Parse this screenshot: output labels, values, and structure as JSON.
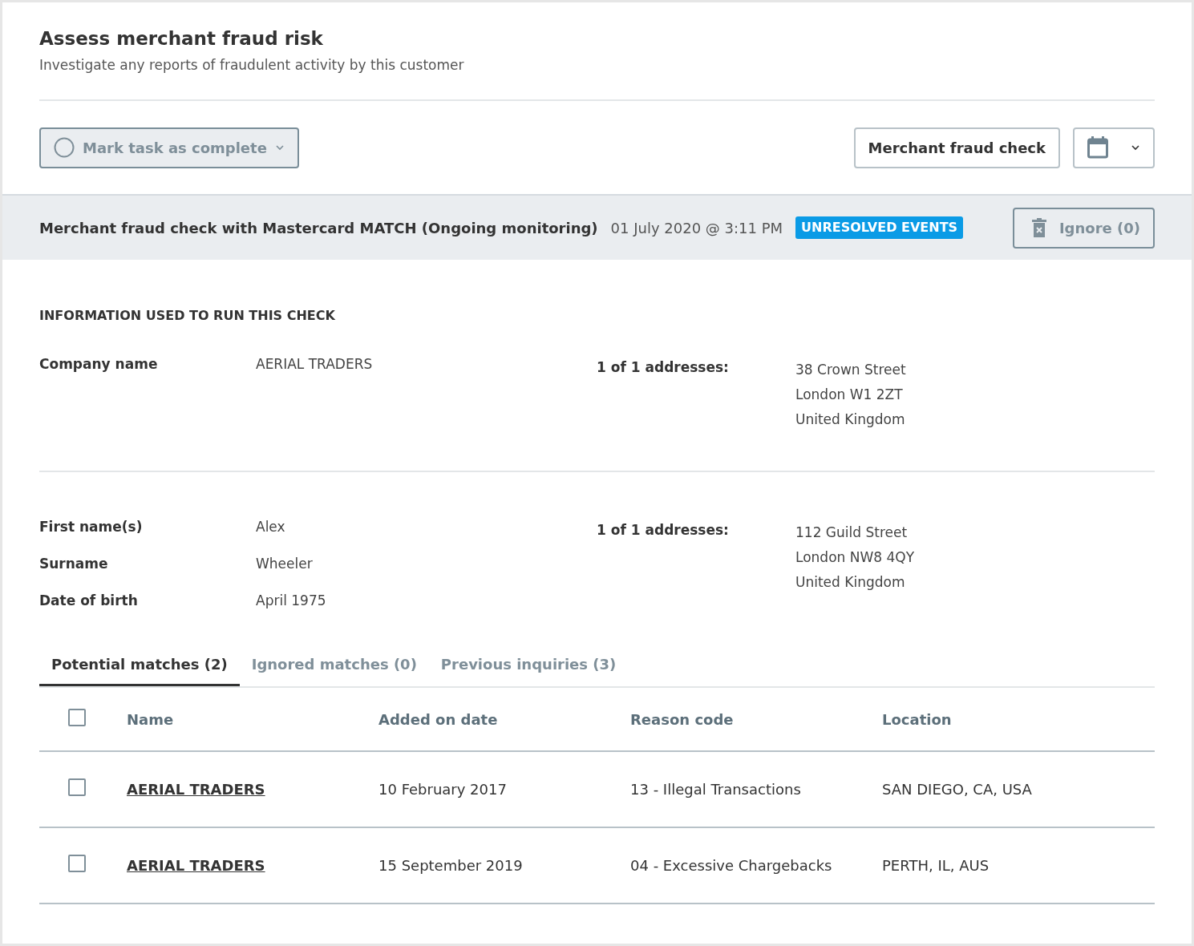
{
  "header": {
    "title": "Assess merchant fraud risk",
    "subtitle": "Investigate any reports of fraudulent activity by this customer"
  },
  "toolbar": {
    "complete_button": {
      "label": "Mark task as complete",
      "disabled": true
    },
    "check_button": {
      "label": "Merchant fraud check"
    }
  },
  "check": {
    "title": "Merchant fraud check with Mastercard MATCH (Ongoing monitoring)",
    "date": "01 July 2020 @ 3:11 PM",
    "status": "UNRESOLVED EVENTS",
    "ignore_button": {
      "label": "Ignore (0)",
      "disabled": true
    }
  },
  "info": {
    "heading": "INFORMATION USED TO RUN THIS CHECK",
    "sections": [
      {
        "fields": [
          {
            "label": "Company name",
            "value": "AERIAL TRADERS"
          }
        ],
        "address_label": "1 of 1 addresses:",
        "address_lines": [
          "38 Crown Street",
          "London W1 2ZT",
          "United Kingdom"
        ]
      },
      {
        "fields": [
          {
            "label": "First name(s)",
            "value": "Alex"
          },
          {
            "label": "Surname",
            "value": "Wheeler"
          },
          {
            "label": "Date of birth",
            "value": "April 1975"
          }
        ],
        "address_label": "1 of 1 addresses:",
        "address_lines": [
          "112 Guild Street",
          "London NW8 4QY",
          "United Kingdom"
        ]
      }
    ]
  },
  "tabs": [
    {
      "label": "Potential matches (2)",
      "selected": true
    },
    {
      "label": "Ignored matches (0)",
      "selected": false
    },
    {
      "label": "Previous inquiries (3)",
      "selected": false
    }
  ],
  "table": {
    "select_all_checked": false,
    "columns": [
      "Name",
      "Added on date",
      "Reason code",
      "Location"
    ],
    "rows": [
      {
        "checked": false,
        "name": "AERIAL TRADERS",
        "added": "10 February 2017",
        "reason": "13 - Illegal Transactions",
        "location": "SAN DIEGO, CA, USA"
      },
      {
        "checked": false,
        "name": "AERIAL TRADERS",
        "added": "15 September 2019",
        "reason": "04 - Excessive Chargebacks",
        "location": "PERTH, IL, AUS"
      }
    ]
  }
}
